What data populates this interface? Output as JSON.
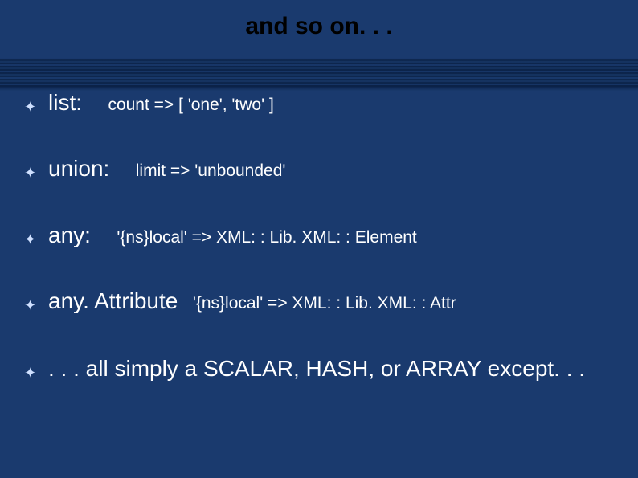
{
  "title": "and so on. . .",
  "items": [
    {
      "label": "list:",
      "detail": "count => [ 'one', 'two' ]"
    },
    {
      "label": "union:",
      "detail": "limit => 'unbounded'"
    },
    {
      "label": "any:",
      "detail": "'{ns}local' => XML: : Lib. XML: : Element"
    },
    {
      "label": "any. Attribute",
      "detail": "'{ns}local' => XML: : Lib. XML: : Attr"
    }
  ],
  "summary": ". . . all simply a SCALAR, HASH, or ARRAY except. . ."
}
